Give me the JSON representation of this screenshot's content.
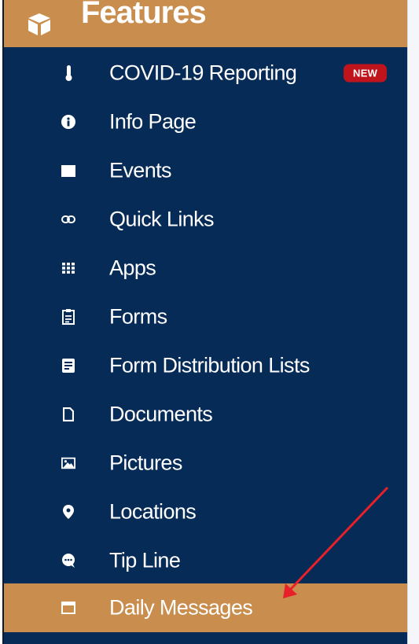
{
  "header": {
    "title": "Features",
    "icon": "cube-icon"
  },
  "items": [
    {
      "label": "COVID-19 Reporting",
      "icon": "thermometer-icon",
      "badge": "NEW"
    },
    {
      "label": "Info Page",
      "icon": "info-circle-icon"
    },
    {
      "label": "Events",
      "icon": "calendar-icon"
    },
    {
      "label": "Quick Links",
      "icon": "link-icon"
    },
    {
      "label": "Apps",
      "icon": "grid-icon"
    },
    {
      "label": "Forms",
      "icon": "clipboard-icon"
    },
    {
      "label": "Form Distribution Lists",
      "icon": "list-icon"
    },
    {
      "label": "Documents",
      "icon": "document-icon"
    },
    {
      "label": "Pictures",
      "icon": "image-icon"
    },
    {
      "label": "Locations",
      "icon": "map-marker-icon"
    },
    {
      "label": "Tip Line",
      "icon": "chat-bubble-icon"
    },
    {
      "label": "Daily Messages",
      "icon": "calendar-blank-icon",
      "active": true
    }
  ],
  "colors": {
    "sidebar_bg": "#062b57",
    "accent": "#c98d4e",
    "badge": "#c0141c",
    "annotation_arrow": "#e8202a"
  }
}
